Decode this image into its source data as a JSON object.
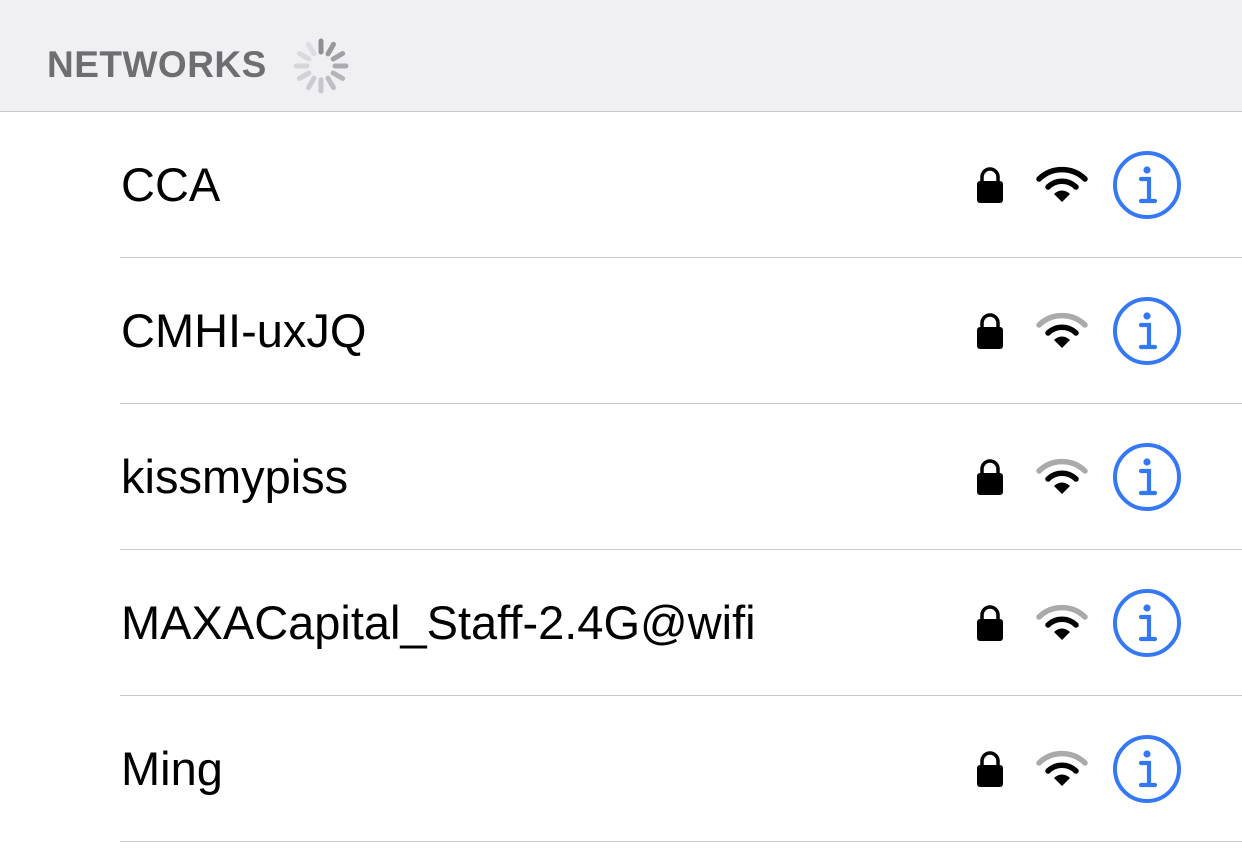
{
  "header": {
    "title": "NETWORKS",
    "activity": "spinner-icon"
  },
  "networks": [
    {
      "name": "CCA",
      "secured": true,
      "signal_bars": 3,
      "info_icon": "info-icon"
    },
    {
      "name": "CMHI-uxJQ",
      "secured": true,
      "signal_bars": 2,
      "info_icon": "info-icon"
    },
    {
      "name": "kissmypiss",
      "secured": true,
      "signal_bars": 2,
      "info_icon": "info-icon"
    },
    {
      "name": "MAXACapital_Staff-2.4G@wifi",
      "secured": true,
      "signal_bars": 2,
      "info_icon": "info-icon"
    },
    {
      "name": "Ming",
      "secured": true,
      "signal_bars": 2,
      "info_icon": "info-icon"
    }
  ],
  "colors": {
    "accent": "#3478f6",
    "header_bg": "#efeff4",
    "header_text": "#6d6d72",
    "separator": "#c8c7cc",
    "signal_active": "#000000",
    "signal_inactive": "#aaaaaa"
  }
}
